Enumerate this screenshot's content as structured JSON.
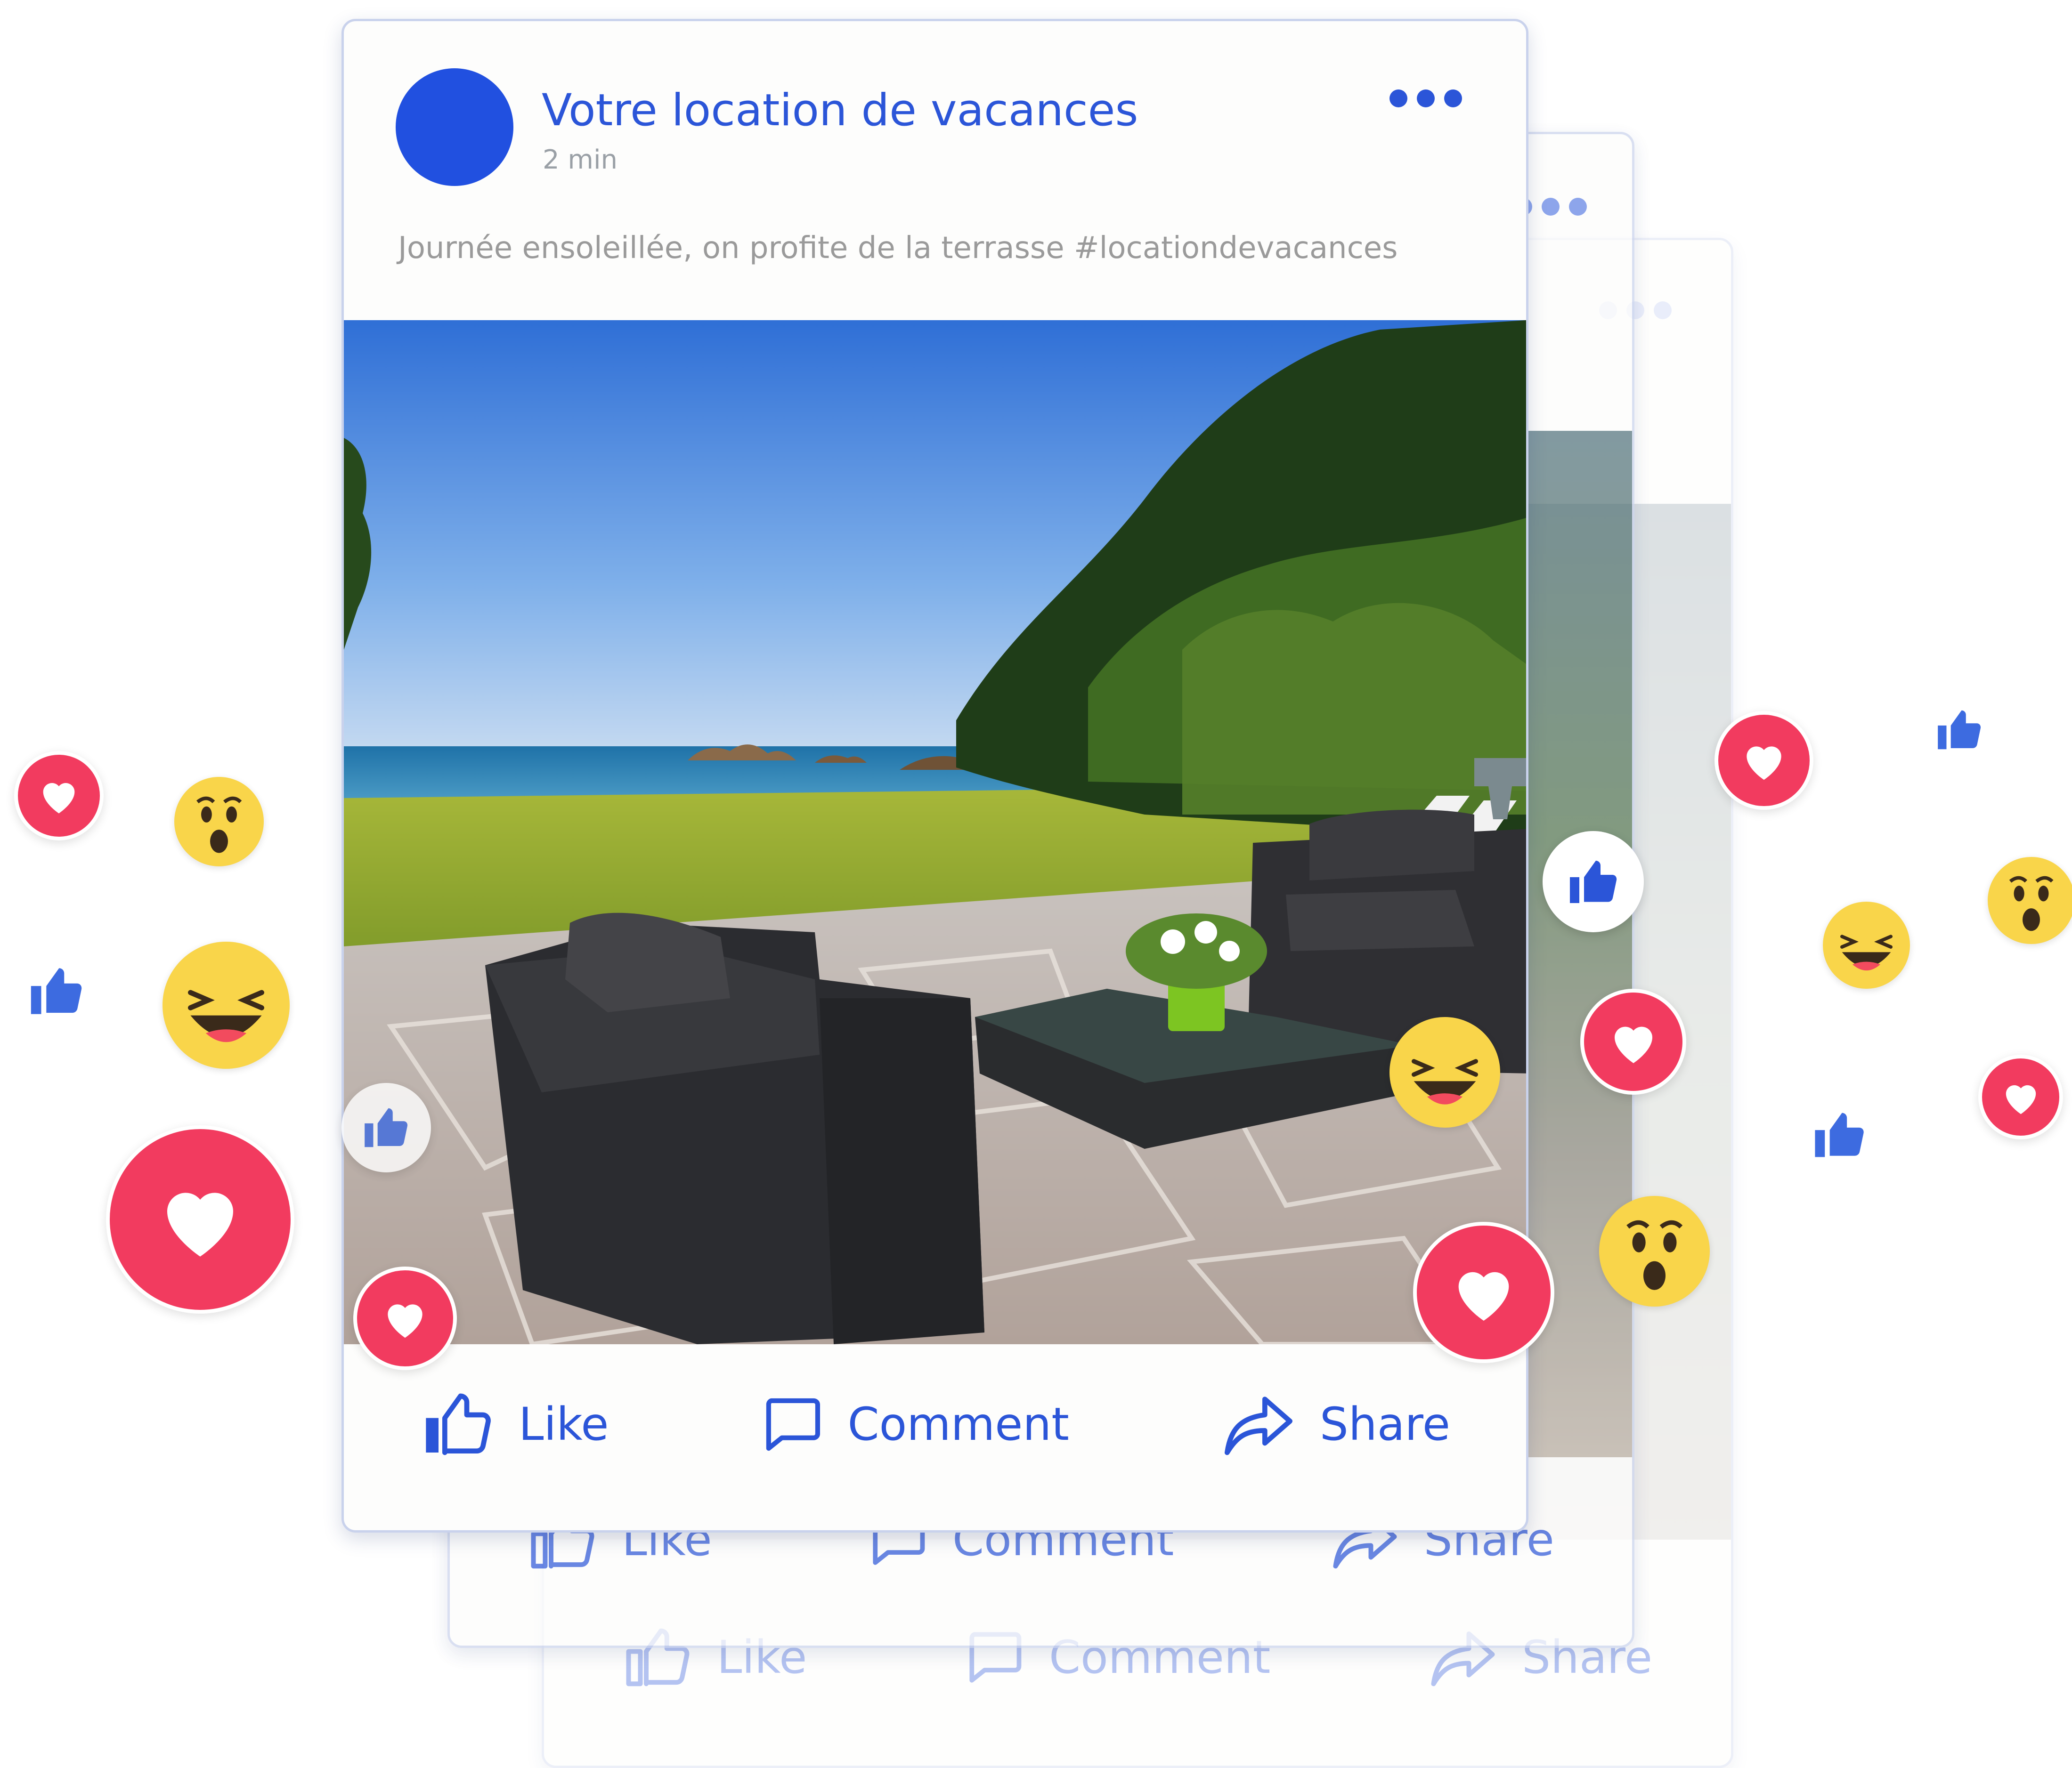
{
  "post": {
    "page_name": "Votre location de vacances",
    "time": "2 min",
    "caption": "Journée ensoleillée, on profite de la terrasse #locationdevacances",
    "image_description": "Terrasse avec salon de jardin en résine tressée face à la mer"
  },
  "actions": {
    "like": "Like",
    "comment": "Comment",
    "share": "Share"
  },
  "icons": {
    "menu": "more-dots-icon",
    "like": "thumbs-up-icon",
    "comment": "comment-bubble-icon",
    "share": "share-arrow-icon",
    "heart": "heart-reaction",
    "wow": "wow-emoji",
    "laugh": "laugh-emoji"
  },
  "colors": {
    "brand_blue": "#2b55d8",
    "heart_red": "#f23b5f",
    "emoji_yellow": "#f9d54a"
  }
}
